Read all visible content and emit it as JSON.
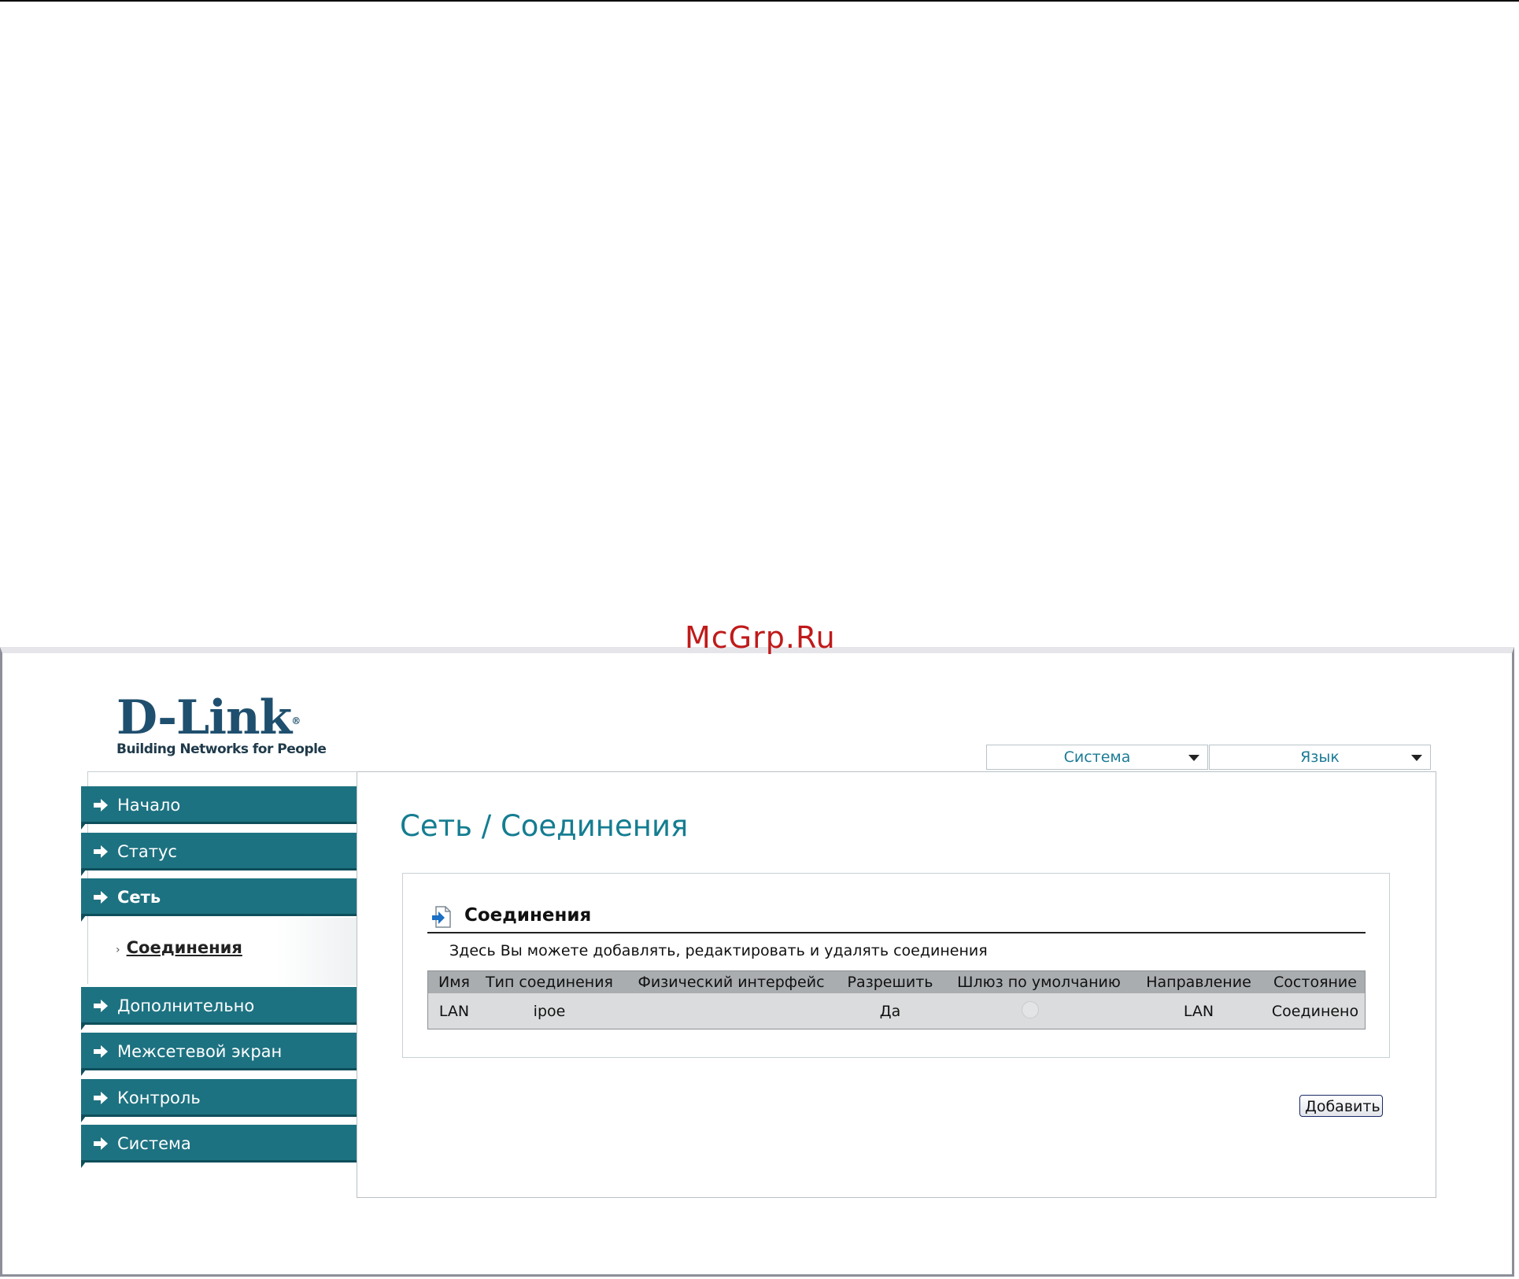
{
  "watermark": "McGrp.Ru",
  "logo": {
    "brand": "D-Link",
    "reg": "®",
    "tagline": "Building Networks for People"
  },
  "top_menus": {
    "system": "Система",
    "language": "Язык"
  },
  "sidebar": {
    "items": [
      {
        "label": "Начало"
      },
      {
        "label": "Статус"
      },
      {
        "label": "Сеть"
      },
      {
        "label": "Дополнительно"
      },
      {
        "label": "Межсетевой экран"
      },
      {
        "label": "Контроль"
      },
      {
        "label": "Система"
      }
    ],
    "sub_items": [
      {
        "label": "Соединения"
      }
    ]
  },
  "page": {
    "title": "Сеть /  Соединения",
    "section_title": "Соединения",
    "section_desc": "Здесь Вы можете добавлять, редактировать и удалять соединения"
  },
  "table": {
    "headers": [
      "Имя",
      "Тип соединения",
      "Физический интерфейс",
      "Разрешить",
      "Шлюз по умолчанию",
      "Направление",
      "Состояние"
    ],
    "rows": [
      {
        "name": "LAN",
        "type": "ipoe",
        "iface": "",
        "enable": "Да",
        "direction": "LAN",
        "status": "Соединено"
      }
    ]
  },
  "buttons": {
    "add": "Добавить"
  }
}
